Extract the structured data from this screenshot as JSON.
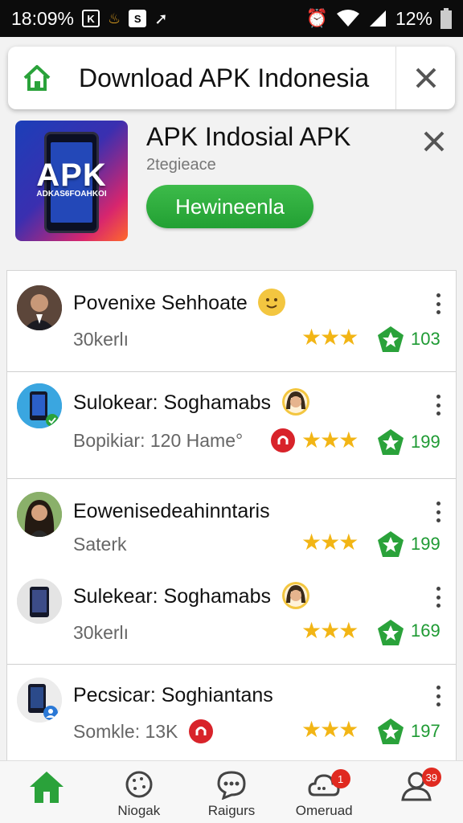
{
  "status_bar": {
    "time": "18:09%",
    "icons": [
      "media-icon",
      "flame-icon",
      "s-icon",
      "arrow-icon"
    ],
    "battery": "12%",
    "right_icons": [
      "alarm-icon",
      "wifi-icon",
      "signal-icon",
      "battery-icon"
    ]
  },
  "search_bar": {
    "title": "Download APK Indonesia",
    "home_icon": "home-icon",
    "close_icon": "close-icon"
  },
  "app": {
    "name": "APK Indosial APK",
    "developer": "2tegieace",
    "icon_text": "APK",
    "icon_subtext": "ADKAS6FOAHKOI",
    "install_label": "Hewineenla",
    "accent": "#22a033"
  },
  "list": [
    {
      "title": "Povenixe Sehhoate",
      "subtitle": "30kerlı",
      "count": "103",
      "stars": "★★★",
      "avatar": "man-avatar",
      "emoji": "smile-emoji"
    },
    {
      "title": "Sulokear: Soghamabs",
      "subtitle": "Bopikiar: 120 Hame°",
      "count": "199",
      "stars": "★★★",
      "avatar": "phone-avatar",
      "emoji": "woman-emoji"
    },
    {
      "title": "Eowenisedeahinntaris",
      "subtitle": "Saterk",
      "count": "199",
      "stars": "★★★",
      "avatar": "woman-avatar"
    },
    {
      "title": "Sulekear: Soghamabs",
      "subtitle": "30kerlı",
      "count": "169",
      "stars": "★★★",
      "avatar": "phone-avatar",
      "emoji": "woman-emoji"
    },
    {
      "title": "Pecsicar: Soghiantans",
      "subtitle": "Somkle: 13K",
      "count": "197",
      "stars": "★★★",
      "avatar": "phone-avatar"
    }
  ],
  "bottom_nav": [
    {
      "label": "",
      "icon": "home-icon",
      "active": true
    },
    {
      "label": "Niogak",
      "icon": "cookie-icon"
    },
    {
      "label": "Raigurs",
      "icon": "chat-icon"
    },
    {
      "label": "Omeruad",
      "icon": "cloud-chat-icon",
      "badge": "1"
    },
    {
      "label": "",
      "icon": "person-icon",
      "badge": "39"
    }
  ],
  "colors": {
    "green": "#22a033",
    "star": "#f2b515",
    "badge_red": "#e02a20"
  }
}
